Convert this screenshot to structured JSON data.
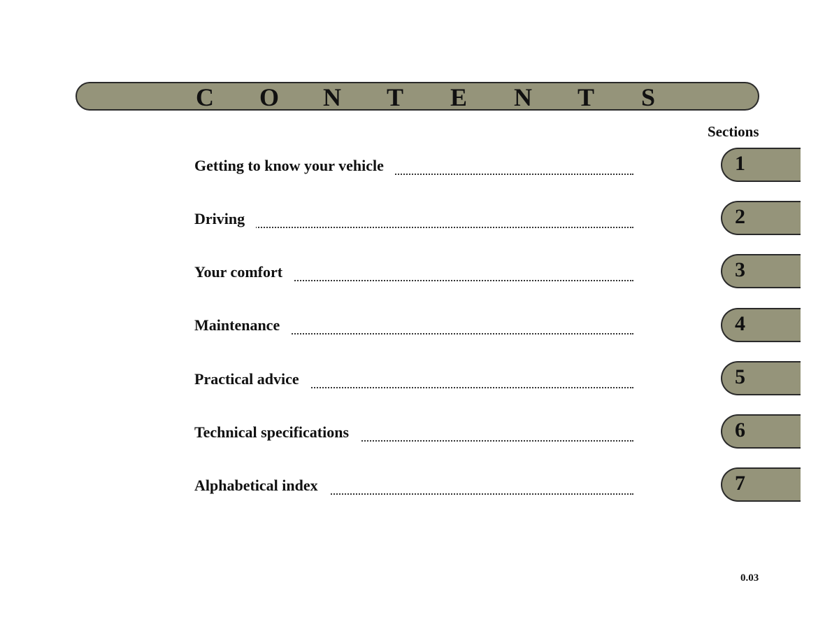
{
  "banner": {
    "letters": [
      "C",
      "O",
      "N",
      "T",
      "E",
      "N",
      "T",
      "S"
    ]
  },
  "sections_label": "Sections",
  "entries": [
    {
      "label": "Getting to know your vehicle",
      "section": "1"
    },
    {
      "label": "Driving",
      "section": "2"
    },
    {
      "label": "Your comfort",
      "section": "3"
    },
    {
      "label": "Maintenance",
      "section": "4"
    },
    {
      "label": "Practical advice",
      "section": "5"
    },
    {
      "label": "Technical specifications",
      "section": "6"
    },
    {
      "label": "Alphabetical index",
      "section": "7"
    }
  ],
  "page_number": "0.03",
  "colors": {
    "tab_fill": "#95947a",
    "outline": "#2a2a2a"
  }
}
